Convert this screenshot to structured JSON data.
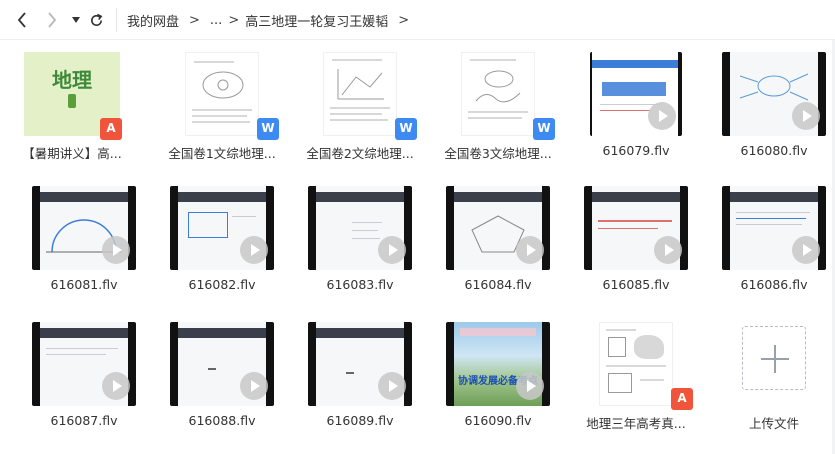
{
  "breadcrumb": {
    "root": "我的网盘",
    "ellipsis": "...",
    "current": "高三地理一轮复习王媛韬",
    "sep1": ">",
    "sep2": ">",
    "sep3": ">"
  },
  "files": [
    {
      "name": "【暑期讲义】高...",
      "type": "pdf",
      "cover_title": "地理"
    },
    {
      "name": "全国卷1文综地理...",
      "type": "word"
    },
    {
      "name": "全国卷2文综地理...",
      "type": "word"
    },
    {
      "name": "全国卷3文综地理...",
      "type": "word"
    },
    {
      "name": "616079.flv",
      "type": "video"
    },
    {
      "name": "616080.flv",
      "type": "video"
    },
    {
      "name": "616081.flv",
      "type": "video"
    },
    {
      "name": "616082.flv",
      "type": "video"
    },
    {
      "name": "616083.flv",
      "type": "video"
    },
    {
      "name": "616084.flv",
      "type": "video"
    },
    {
      "name": "616085.flv",
      "type": "video"
    },
    {
      "name": "616086.flv",
      "type": "video"
    },
    {
      "name": "616087.flv",
      "type": "video"
    },
    {
      "name": "616088.flv",
      "type": "video"
    },
    {
      "name": "616089.flv",
      "type": "video"
    },
    {
      "name": "616090.flv",
      "type": "video",
      "banner": "协调发展必备考点"
    },
    {
      "name": "地理三年高考真...",
      "type": "pdf"
    }
  ],
  "upload": {
    "label": "上传文件"
  },
  "colors": {
    "pdf": "#f0553b",
    "word": "#3d8bf2",
    "accent": "#3b7dd8"
  }
}
